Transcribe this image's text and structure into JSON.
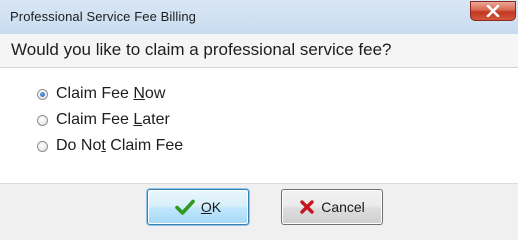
{
  "window": {
    "title": "Professional Service Fee Billing",
    "close_icon": "close-icon"
  },
  "prompt": {
    "question": "Would you like to claim a professional service fee?"
  },
  "options": [
    {
      "label_pre": "Claim Fee ",
      "label_ul": "N",
      "label_post": "ow",
      "selected": true
    },
    {
      "label_pre": "Claim Fee ",
      "label_ul": "L",
      "label_post": "ater",
      "selected": false
    },
    {
      "label_pre": "Do No",
      "label_ul": "t",
      "label_post": " Claim Fee",
      "selected": false
    }
  ],
  "buttons": {
    "ok": {
      "label_ul": "O",
      "label_post": "K",
      "icon": "checkmark-icon"
    },
    "cancel": {
      "label": "Cancel",
      "icon": "red-x-icon"
    }
  },
  "colors": {
    "ok_check": "#2e9a1f",
    "cancel_x": "#c8141e",
    "close_button": "#c43b22"
  }
}
